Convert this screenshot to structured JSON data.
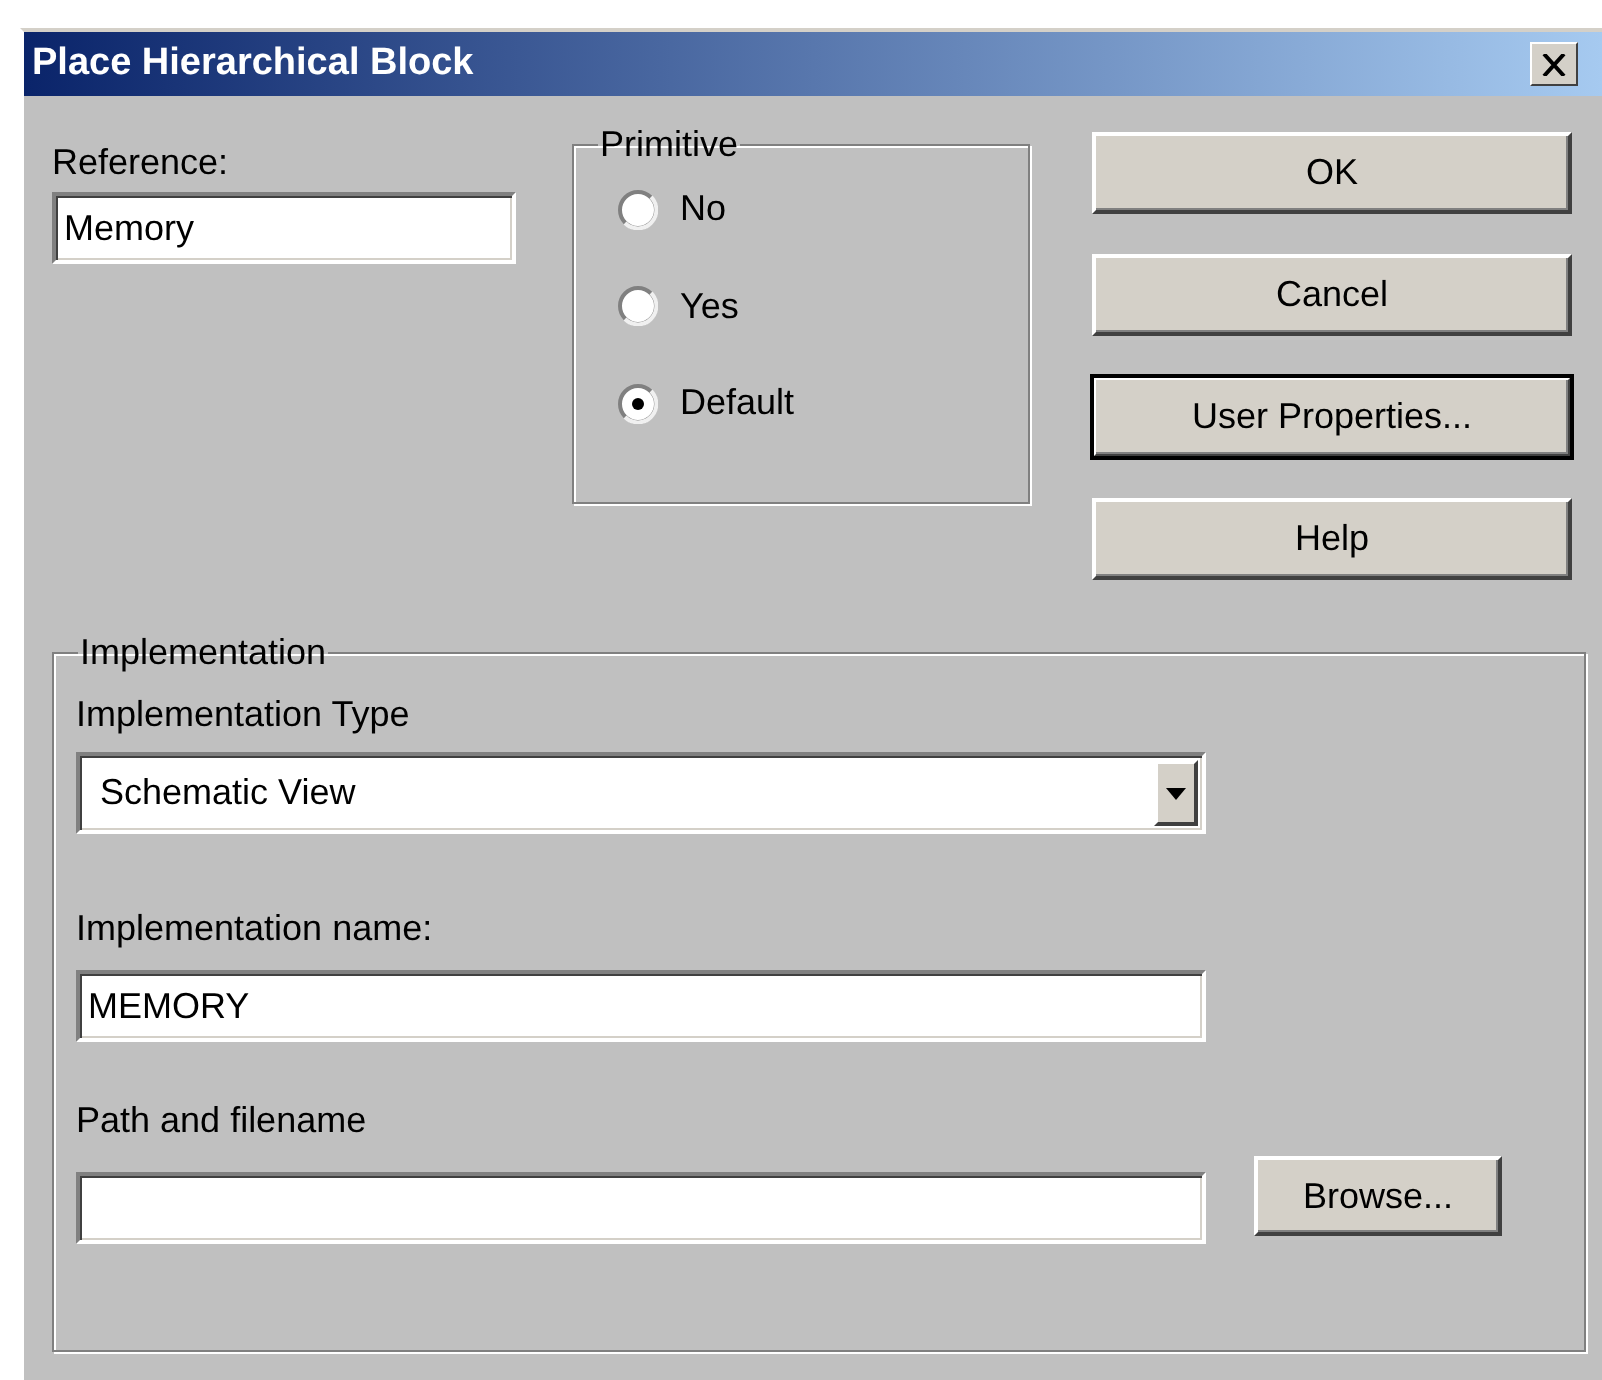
{
  "window": {
    "title": "Place Hierarchical Block"
  },
  "reference": {
    "label": "Reference:",
    "value": "Memory"
  },
  "primitive": {
    "title": "Primitive",
    "options": [
      {
        "label": "No",
        "selected": false
      },
      {
        "label": "Yes",
        "selected": false
      },
      {
        "label": "Default",
        "selected": true
      }
    ]
  },
  "buttons": [
    {
      "label": "OK",
      "default": false
    },
    {
      "label": "Cancel",
      "default": false
    },
    {
      "label": "User Properties...",
      "default": true
    },
    {
      "label": "Help",
      "default": false
    }
  ],
  "implementation": {
    "title": "Implementation",
    "type_label": "Implementation Type",
    "type_value": "Schematic View",
    "name_label": "Implementation name:",
    "name_value": "MEMORY",
    "path_label": "Path and filename",
    "browse_button": "Browse..."
  }
}
